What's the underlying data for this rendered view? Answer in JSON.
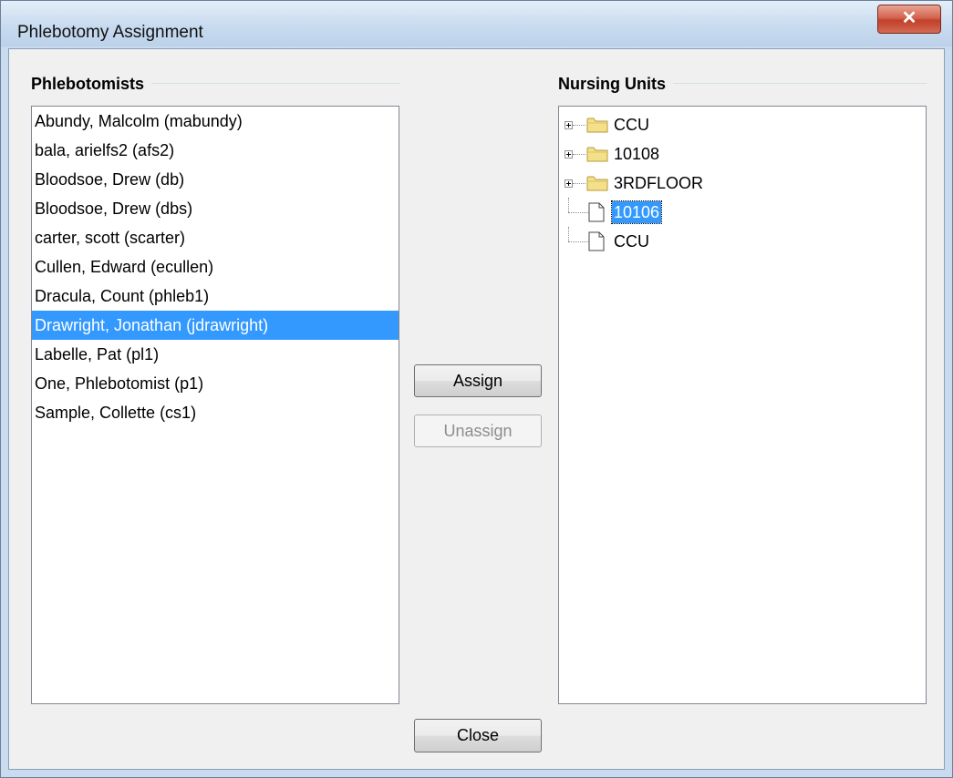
{
  "window": {
    "title": "Phlebotomy Assignment",
    "close_glyph": "✕"
  },
  "phlebotomists": {
    "heading": "Phlebotomists",
    "items": [
      "Abundy, Malcolm (mabundy)",
      "bala, arielfs2 (afs2)",
      "Bloodsoe, Drew (db)",
      "Bloodsoe, Drew (dbs)",
      "carter, scott (scarter)",
      "Cullen, Edward (ecullen)",
      "Dracula, Count (phleb1)",
      "Drawright, Jonathan (jdrawright)",
      "Labelle, Pat (pl1)",
      "One, Phlebotomist (p1)",
      "Sample, Collette (cs1)"
    ],
    "selected_index": 7
  },
  "nursing_units": {
    "heading": "Nursing Units",
    "nodes": [
      {
        "label": "CCU",
        "icon": "folder-icon",
        "expandable": true,
        "selected": false
      },
      {
        "label": "10108",
        "icon": "folder-icon",
        "expandable": true,
        "selected": false
      },
      {
        "label": "3RDFLOOR",
        "icon": "folder-icon",
        "expandable": true,
        "selected": false
      },
      {
        "label": "10106",
        "icon": "document-icon",
        "expandable": false,
        "selected": true
      },
      {
        "label": "CCU",
        "icon": "document-icon",
        "expandable": false,
        "selected": false
      }
    ]
  },
  "buttons": {
    "assign": "Assign",
    "unassign": "Unassign",
    "unassign_enabled": false,
    "close": "Close"
  },
  "colors": {
    "selection": "#3399ff",
    "folder": "#f5e08a",
    "title_bar": "#c8dbef",
    "close_button": "#c7432c"
  }
}
